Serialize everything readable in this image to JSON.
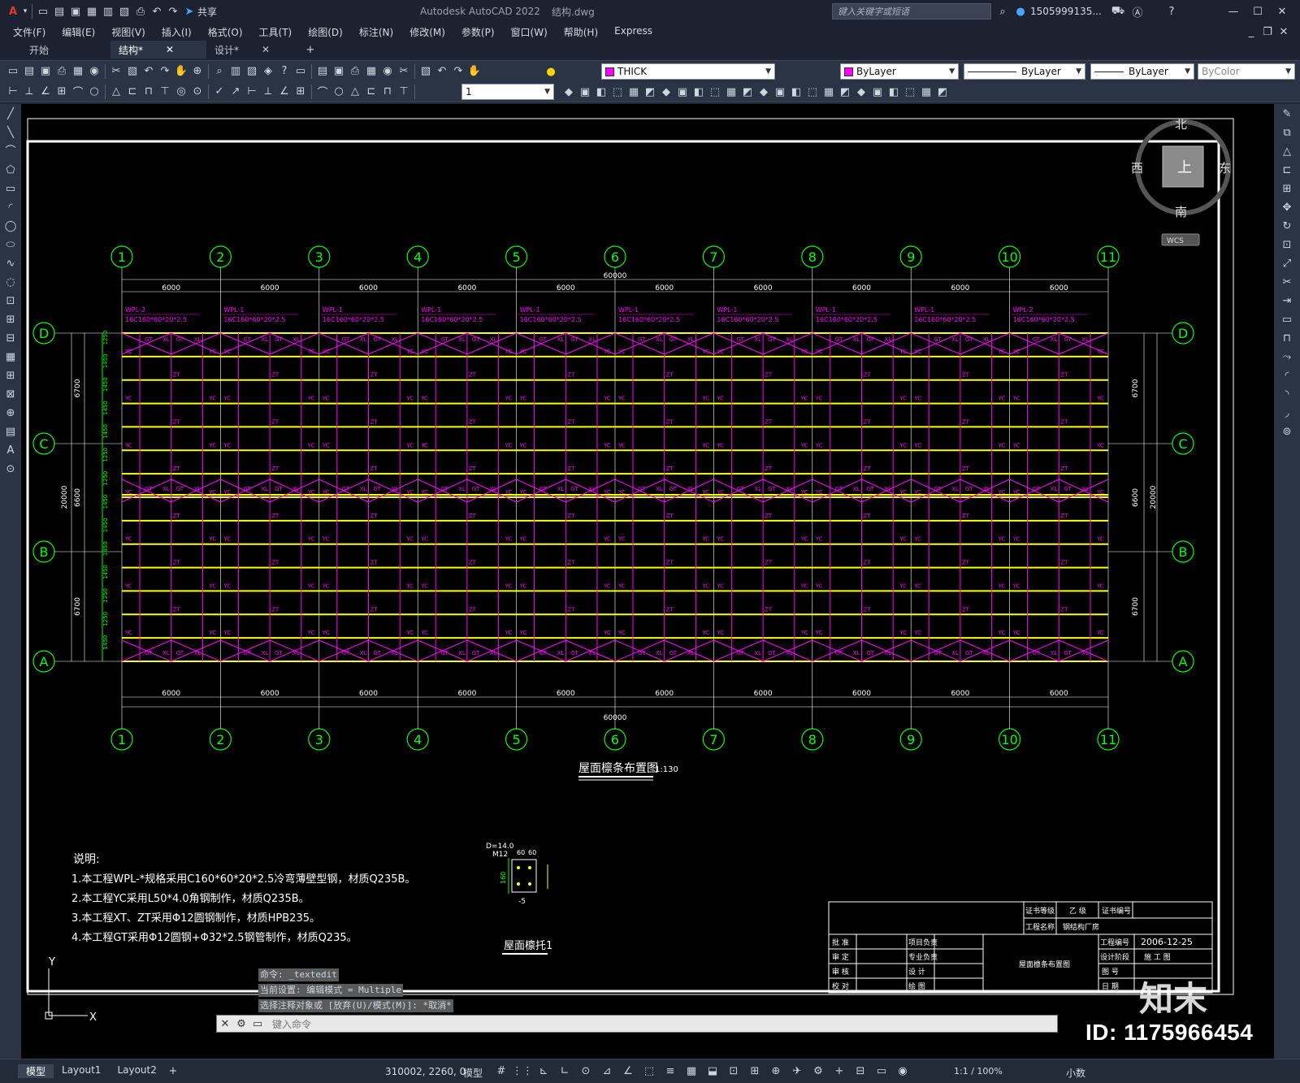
{
  "app": {
    "title": "Autodesk AutoCAD 2022",
    "file": "结构.dwg",
    "search_placeholder": "键入关键字或短语",
    "user": "1505999135...",
    "share": "共享"
  },
  "menu": [
    "文件(F)",
    "编辑(E)",
    "视图(V)",
    "插入(I)",
    "格式(O)",
    "工具(T)",
    "绘图(D)",
    "标注(N)",
    "修改(M)",
    "参数(P)",
    "窗口(W)",
    "帮助(H)",
    "Express"
  ],
  "tabs": [
    {
      "label": "开始"
    },
    {
      "label": "结构*"
    },
    {
      "label": "设计*"
    }
  ],
  "toolbar": {
    "layer": "THICK",
    "color": "ByLayer",
    "linetype": "ByLayer",
    "lineweight": "ByLayer",
    "plotstyle": "ByColor",
    "scale_value": "1"
  },
  "viewcube": {
    "north": "北",
    "south": "南",
    "east": "东",
    "west": "西",
    "top": "上",
    "wcs": "WCS"
  },
  "drawing": {
    "grid_numbers": [
      "1",
      "2",
      "3",
      "4",
      "5",
      "6",
      "7",
      "8",
      "9",
      "10",
      "11"
    ],
    "grid_letters": [
      "D",
      "C",
      "B",
      "A"
    ],
    "bay_dim": "6000",
    "total_dim": "60000",
    "left_dims": [
      "6700",
      "6600",
      "6700",
      "20000"
    ],
    "right_dims": [
      "6700",
      "6600",
      "6700",
      "20000"
    ],
    "sub_dims": [
      "1250",
      "1450",
      "1450",
      "1450",
      "1450",
      "1250"
    ],
    "purlin_labels": [
      "WPL-2",
      "WPL-1",
      "WPL-1",
      "WPL-1",
      "WPL-1",
      "WPL-1",
      "WPL-1",
      "WPL-1",
      "WPL-1",
      "WPL-2"
    ],
    "purlin_spec": "16C160*60*20*2.5",
    "members": [
      "GT",
      "XL",
      "YC",
      "ZT"
    ],
    "plan_title": "屋面檩条布置图",
    "plan_scale": "1:130",
    "notes_title": "说明:",
    "notes": [
      "1.本工程WPL-*规格采用C160*60*20*2.5冷弯薄壁型钢，材质Q235B。",
      "2.本工程YC采用L50*4.0角钢制作，材质Q235B。",
      "3.本工程XT、ZT采用Φ12圆钢制作，材质HPB235。",
      "4.本工程GT采用Φ12圆钢+Φ32*2.5钢管制作，材质Q235。"
    ],
    "detail_title": "屋面檩托1",
    "detail_labels": [
      "D=14.0",
      "M12",
      "60",
      "60",
      "-5",
      "160"
    ],
    "titleblock": {
      "cert_level_label": "证书等级",
      "cert_level": "乙 级",
      "cert_no_label": "证书编号",
      "project_label": "工程名称",
      "project": "钢结构厂房",
      "drawing_name": "屋面檩条布置图",
      "proj_no_label": "工程编号",
      "date": "2006-12-25",
      "stage_label": "设计阶段",
      "stage": "施 工 图",
      "rows_left": [
        "批 准",
        "审 定",
        "审 核",
        "校 对"
      ],
      "rows_mid": [
        "项目负责",
        "专业负责",
        "设 计",
        "绘 图"
      ],
      "rows_right": [
        "图 号",
        "日 期"
      ]
    }
  },
  "command_history": [
    "命令: _textedit",
    "当前设置: 编辑模式 = Multiple",
    "选择注释对象或 [放弃(U)/模式(M)]: *取消*"
  ],
  "command_prompt": "键入命令",
  "status": {
    "coords": "310002, 2260, 0",
    "model": "模型",
    "scale": "1:1 / 100%",
    "units": "小数"
  },
  "layout_tabs": [
    "模型",
    "Layout1",
    "Layout2"
  ],
  "watermark_id": "ID: 1175966454",
  "watermark_brand": "知末"
}
